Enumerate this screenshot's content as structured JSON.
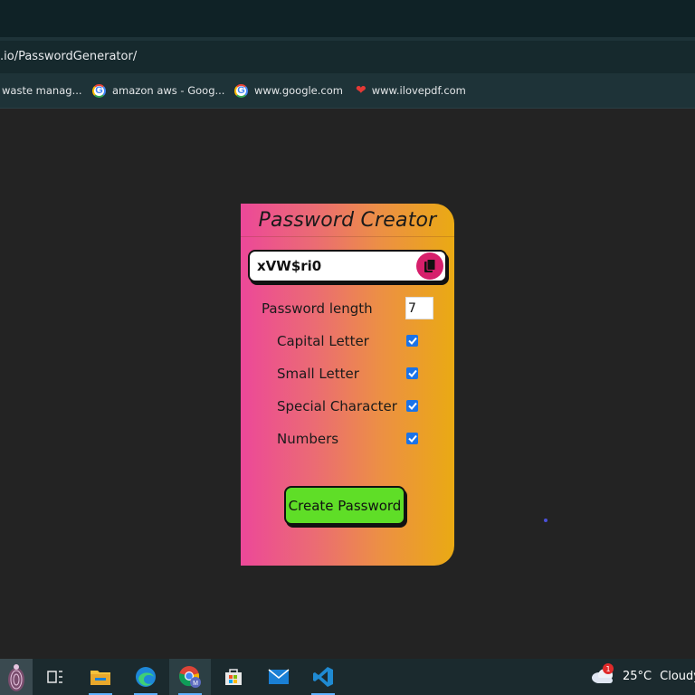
{
  "browser": {
    "url": ".io/PasswordGenerator/",
    "bookmarks": [
      {
        "label": "waste manag...",
        "icon": "globe-icon"
      },
      {
        "label": "amazon aws - Goog...",
        "icon": "google-icon"
      },
      {
        "label": "www.google.com",
        "icon": "google-icon"
      },
      {
        "label": "www.ilovepdf.com",
        "icon": "heart-icon"
      }
    ]
  },
  "card": {
    "title": "Password Creator",
    "password": "xVW$ri0",
    "copy_icon": "copy-icon",
    "length_label": "Password length",
    "length_value": "7",
    "options": [
      {
        "label": "Capital Letter",
        "checked": true
      },
      {
        "label": "Small Letter",
        "checked": true
      },
      {
        "label": "Special Character",
        "checked": true
      },
      {
        "label": "Numbers",
        "checked": true
      }
    ],
    "create_label": "Create Password"
  },
  "taskbar": {
    "apps": [
      "start-icon",
      "task-view-icon",
      "file-explorer-icon",
      "edge-icon",
      "chrome-icon",
      "store-icon",
      "mail-icon",
      "vscode-icon"
    ],
    "weather": {
      "badge": "1",
      "temp": "25°C",
      "condition": "Cloudy"
    }
  },
  "colors": {
    "card_gradient_start": "#ec4899",
    "card_gradient_end": "#eaaa13",
    "create_button": "#5fde27",
    "copy_button": "#d61f6b"
  }
}
